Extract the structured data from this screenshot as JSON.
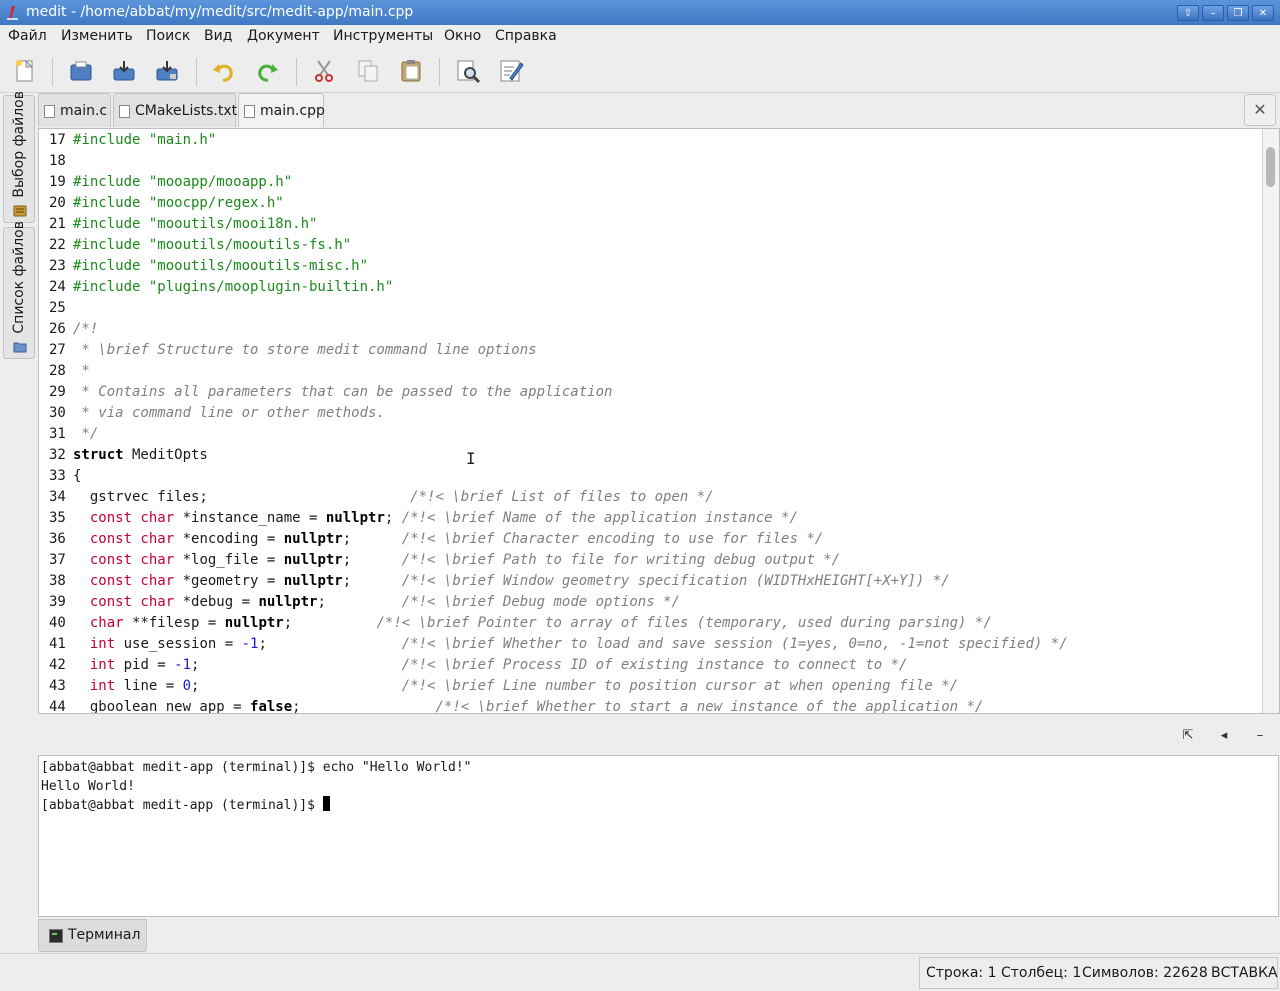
{
  "window": {
    "title": "medit - /home/abbat/my/medit/src/medit-app/main.cpp",
    "buttons": [
      "⇧",
      "–",
      "❐",
      "✕"
    ]
  },
  "menu": [
    "Файл",
    "Изменить",
    "Поиск",
    "Вид",
    "Документ",
    "Инструменты",
    "Окно",
    "Справка"
  ],
  "toolbar": [
    "new-file-icon",
    "open-icon",
    "save-icon",
    "save-as-icon",
    "undo-icon",
    "redo-icon",
    "cut-icon",
    "copy-icon",
    "paste-icon",
    "find-icon",
    "preferences-icon"
  ],
  "sidebar": {
    "tabs": [
      {
        "label": "Выбор файлов",
        "icon": "file-selector-icon"
      },
      {
        "label": "Список файлов",
        "icon": "folder-icon"
      }
    ]
  },
  "tabs": [
    {
      "label": "main.c"
    },
    {
      "label": "CMakeLists.txt"
    },
    {
      "label": "main.cpp"
    }
  ],
  "close_all_label": "✕",
  "colors": {
    "string": "#1c8a1c",
    "comment": "#808080",
    "keyword": "#c4003c",
    "number": "#1a1ad6",
    "bold": "#000000"
  },
  "code": [
    {
      "n": "17",
      "parts": [
        {
          "t": "#include ",
          "c": "string"
        },
        {
          "t": "\"main.h\"",
          "c": "string"
        }
      ]
    },
    {
      "n": "18",
      "parts": []
    },
    {
      "n": "19",
      "parts": [
        {
          "t": "#include ",
          "c": "string"
        },
        {
          "t": "\"mooapp/mooapp.h\"",
          "c": "string"
        }
      ]
    },
    {
      "n": "20",
      "parts": [
        {
          "t": "#include ",
          "c": "string"
        },
        {
          "t": "\"moocpp/regex.h\"",
          "c": "string"
        }
      ]
    },
    {
      "n": "21",
      "parts": [
        {
          "t": "#include ",
          "c": "string"
        },
        {
          "t": "\"mooutils/mooi18n.h\"",
          "c": "string"
        }
      ]
    },
    {
      "n": "22",
      "parts": [
        {
          "t": "#include ",
          "c": "string"
        },
        {
          "t": "\"mooutils/mooutils-fs.h\"",
          "c": "string"
        }
      ]
    },
    {
      "n": "23",
      "parts": [
        {
          "t": "#include ",
          "c": "string"
        },
        {
          "t": "\"mooutils/mooutils-misc.h\"",
          "c": "string"
        }
      ]
    },
    {
      "n": "24",
      "parts": [
        {
          "t": "#include ",
          "c": "string"
        },
        {
          "t": "\"plugins/mooplugin-builtin.h\"",
          "c": "string"
        }
      ]
    },
    {
      "n": "25",
      "parts": []
    },
    {
      "n": "26",
      "parts": [
        {
          "t": "/*!",
          "c": "comment"
        }
      ]
    },
    {
      "n": "27",
      "parts": [
        {
          "t": " * \\brief Structure to store medit command line options",
          "c": "comment"
        }
      ]
    },
    {
      "n": "28",
      "parts": [
        {
          "t": " *",
          "c": "comment"
        }
      ]
    },
    {
      "n": "29",
      "parts": [
        {
          "t": " * Contains all parameters that can be passed to the application",
          "c": "comment"
        }
      ]
    },
    {
      "n": "30",
      "parts": [
        {
          "t": " * via command line or other methods.",
          "c": "comment"
        }
      ]
    },
    {
      "n": "31",
      "parts": [
        {
          "t": " */",
          "c": "comment"
        }
      ]
    },
    {
      "n": "32",
      "parts": [
        {
          "t": "struct",
          "c": "bold"
        },
        {
          "t": " MeditOpts",
          "c": ""
        }
      ]
    },
    {
      "n": "33",
      "parts": [
        {
          "t": "{",
          "c": ""
        }
      ]
    },
    {
      "n": "34",
      "parts": [
        {
          "t": "  gstrvec files;                        ",
          "c": ""
        },
        {
          "t": "/*!< \\brief List of files to open */",
          "c": "comment"
        }
      ]
    },
    {
      "n": "35",
      "parts": [
        {
          "t": "  ",
          "c": ""
        },
        {
          "t": "const char",
          "c": "keyword"
        },
        {
          "t": " *instance_name = ",
          "c": ""
        },
        {
          "t": "nullptr",
          "c": "bold"
        },
        {
          "t": "; ",
          "c": ""
        },
        {
          "t": "/*!< \\brief Name of the application instance */",
          "c": "comment"
        }
      ]
    },
    {
      "n": "36",
      "parts": [
        {
          "t": "  ",
          "c": ""
        },
        {
          "t": "const char",
          "c": "keyword"
        },
        {
          "t": " *encoding = ",
          "c": ""
        },
        {
          "t": "nullptr",
          "c": "bold"
        },
        {
          "t": ";      ",
          "c": ""
        },
        {
          "t": "/*!< \\brief Character encoding to use for files */",
          "c": "comment"
        }
      ]
    },
    {
      "n": "37",
      "parts": [
        {
          "t": "  ",
          "c": ""
        },
        {
          "t": "const char",
          "c": "keyword"
        },
        {
          "t": " *log_file = ",
          "c": ""
        },
        {
          "t": "nullptr",
          "c": "bold"
        },
        {
          "t": ";      ",
          "c": ""
        },
        {
          "t": "/*!< \\brief Path to file for writing debug output */",
          "c": "comment"
        }
      ]
    },
    {
      "n": "38",
      "parts": [
        {
          "t": "  ",
          "c": ""
        },
        {
          "t": "const char",
          "c": "keyword"
        },
        {
          "t": " *geometry = ",
          "c": ""
        },
        {
          "t": "nullptr",
          "c": "bold"
        },
        {
          "t": ";      ",
          "c": ""
        },
        {
          "t": "/*!< \\brief Window geometry specification (WIDTHxHEIGHT[+X+Y]) */",
          "c": "comment"
        }
      ]
    },
    {
      "n": "39",
      "parts": [
        {
          "t": "  ",
          "c": ""
        },
        {
          "t": "const char",
          "c": "keyword"
        },
        {
          "t": " *debug = ",
          "c": ""
        },
        {
          "t": "nullptr",
          "c": "bold"
        },
        {
          "t": ";         ",
          "c": ""
        },
        {
          "t": "/*!< \\brief Debug mode options */",
          "c": "comment"
        }
      ]
    },
    {
      "n": "40",
      "parts": [
        {
          "t": "  ",
          "c": ""
        },
        {
          "t": "char",
          "c": "keyword"
        },
        {
          "t": " **filesp = ",
          "c": ""
        },
        {
          "t": "nullptr",
          "c": "bold"
        },
        {
          "t": ";          ",
          "c": ""
        },
        {
          "t": "/*!< \\brief Pointer to array of files (temporary, used during parsing) */",
          "c": "comment"
        }
      ]
    },
    {
      "n": "41",
      "parts": [
        {
          "t": "  ",
          "c": ""
        },
        {
          "t": "int",
          "c": "keyword"
        },
        {
          "t": " use_session = ",
          "c": ""
        },
        {
          "t": "-1",
          "c": "number"
        },
        {
          "t": ";                ",
          "c": ""
        },
        {
          "t": "/*!< \\brief Whether to load and save session (1=yes, 0=no, -1=not specified) */",
          "c": "comment"
        }
      ]
    },
    {
      "n": "42",
      "parts": [
        {
          "t": "  ",
          "c": ""
        },
        {
          "t": "int",
          "c": "keyword"
        },
        {
          "t": " pid = ",
          "c": ""
        },
        {
          "t": "-1",
          "c": "number"
        },
        {
          "t": ";                        ",
          "c": ""
        },
        {
          "t": "/*!< \\brief Process ID of existing instance to connect to */",
          "c": "comment"
        }
      ]
    },
    {
      "n": "43",
      "parts": [
        {
          "t": "  ",
          "c": ""
        },
        {
          "t": "int",
          "c": "keyword"
        },
        {
          "t": " line = ",
          "c": ""
        },
        {
          "t": "0",
          "c": "number"
        },
        {
          "t": ";                        ",
          "c": ""
        },
        {
          "t": "/*!< \\brief Line number to position cursor at when opening file */",
          "c": "comment"
        }
      ]
    },
    {
      "n": "44",
      "parts": [
        {
          "t": "  gboolean new_app = ",
          "c": ""
        },
        {
          "t": "false",
          "c": "bold"
        },
        {
          "t": ";                ",
          "c": ""
        },
        {
          "t": "/*!< \\brief Whether to start a new instance of the application */",
          "c": "comment"
        }
      ]
    }
  ],
  "panel": {
    "buttons": [
      "⇱",
      "◂",
      "–"
    ]
  },
  "terminal": {
    "lines": [
      "[abbat@abbat medit-app (terminal)]$ echo \"Hello World!\"",
      "Hello World!",
      "[abbat@abbat medit-app (terminal)]$ "
    ],
    "tab_label": "Терминал"
  },
  "status": {
    "position": "Строка: 1 Столбец: 1",
    "chars": "Символов: 22628",
    "mode": "ВСТАВКА"
  }
}
